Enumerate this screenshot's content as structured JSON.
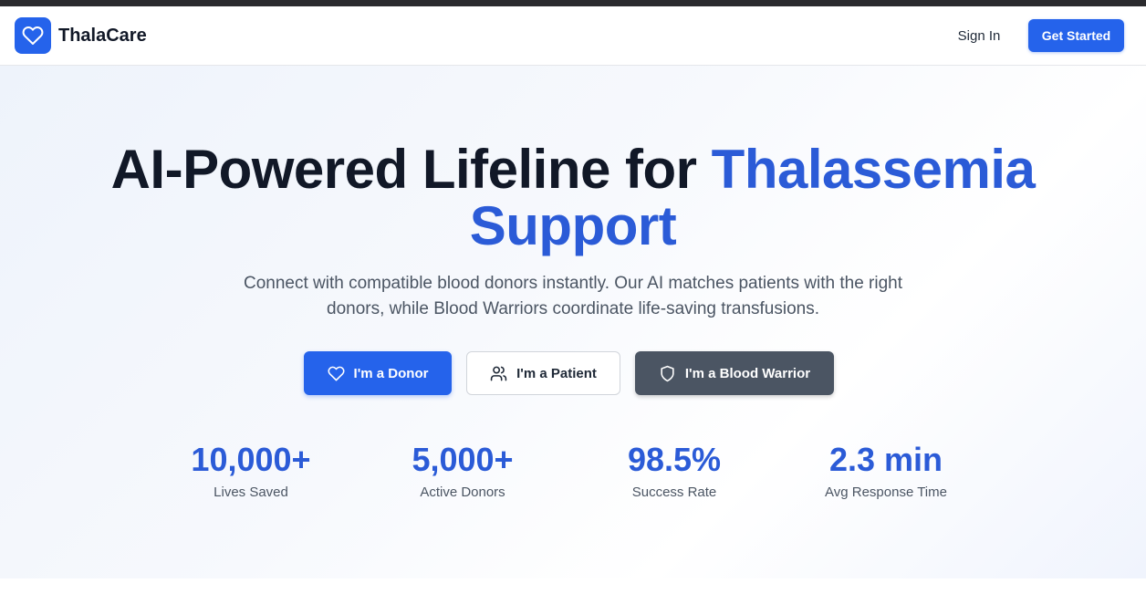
{
  "nav": {
    "brand": "ThalaCare",
    "signin_label": "Sign In",
    "get_started_label": "Get Started"
  },
  "hero": {
    "headline_part1": "AI-Powered Lifeline for ",
    "headline_accent_line1": "Thalassemia",
    "headline_accent_line2": "Support",
    "subtext": "Connect with compatible blood donors instantly. Our AI matches patients with the right donors, while Blood Warriors coordinate life-saving transfusions.",
    "buttons": [
      {
        "label": "I'm a Donor",
        "icon": "heart-icon"
      },
      {
        "label": "I'm a Patient",
        "icon": "users-icon"
      },
      {
        "label": "I'm a Blood Warrior",
        "icon": "shield-icon"
      }
    ]
  },
  "stats": [
    {
      "value": "10,000+",
      "label": "Lives Saved"
    },
    {
      "value": "5,000+",
      "label": "Active Donors"
    },
    {
      "value": "98.5%",
      "label": "Success Rate"
    },
    {
      "value": "2.3 min",
      "label": "Avg Response Time"
    }
  ],
  "colors": {
    "primary": "#2563eb",
    "accent_text": "#2b5bd7",
    "warrior_button": "#4b5563",
    "heading": "#111827"
  }
}
